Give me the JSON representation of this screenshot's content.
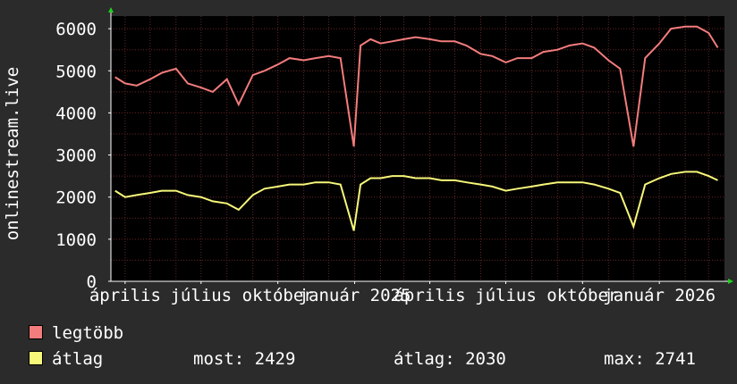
{
  "chart_data": {
    "type": "line",
    "title": "",
    "xlabel": "",
    "ylabel": "onlinestream.live",
    "ylim": [
      0,
      6300
    ],
    "yticks": [
      0,
      1000,
      2000,
      3000,
      4000,
      5000,
      6000
    ],
    "xlim": [
      "2024-03-15",
      "2026-03-20"
    ],
    "xticks": [
      {
        "date": "2024-04-01",
        "label": "április"
      },
      {
        "date": "2024-07-01",
        "label": "július"
      },
      {
        "date": "2024-10-01",
        "label": "október"
      },
      {
        "date": "2025-01-01",
        "label": "január 2025"
      },
      {
        "date": "2025-04-01",
        "label": "április"
      },
      {
        "date": "2025-07-01",
        "label": "július"
      },
      {
        "date": "2025-10-01",
        "label": "október"
      },
      {
        "date": "2026-01-01",
        "label": "január 2026"
      }
    ],
    "grid": true,
    "colors": {
      "max": "#f37c7c",
      "avg": "#f7f77a",
      "background": "#2b2b2b",
      "plot": "#000000",
      "grid": "#6a2525"
    },
    "series": [
      {
        "name": "legtöbb",
        "color": "#f37c7c",
        "points": [
          [
            "2024-03-20",
            4850
          ],
          [
            "2024-04-01",
            4700
          ],
          [
            "2024-04-15",
            4650
          ],
          [
            "2024-05-01",
            4800
          ],
          [
            "2024-05-15",
            4950
          ],
          [
            "2024-06-01",
            5050
          ],
          [
            "2024-06-15",
            4700
          ],
          [
            "2024-07-01",
            4600
          ],
          [
            "2024-07-15",
            4500
          ],
          [
            "2024-08-01",
            4800
          ],
          [
            "2024-08-15",
            4200
          ],
          [
            "2024-09-01",
            4900
          ],
          [
            "2024-09-15",
            5000
          ],
          [
            "2024-10-01",
            5150
          ],
          [
            "2024-10-15",
            5300
          ],
          [
            "2024-11-01",
            5250
          ],
          [
            "2024-11-15",
            5300
          ],
          [
            "2024-12-01",
            5350
          ],
          [
            "2024-12-15",
            5300
          ],
          [
            "2024-12-31",
            3200
          ],
          [
            "2025-01-08",
            5600
          ],
          [
            "2025-01-20",
            5750
          ],
          [
            "2025-02-01",
            5650
          ],
          [
            "2025-02-15",
            5700
          ],
          [
            "2025-03-01",
            5750
          ],
          [
            "2025-03-15",
            5800
          ],
          [
            "2025-04-01",
            5750
          ],
          [
            "2025-04-15",
            5700
          ],
          [
            "2025-05-01",
            5700
          ],
          [
            "2025-05-15",
            5600
          ],
          [
            "2025-06-01",
            5400
          ],
          [
            "2025-06-15",
            5350
          ],
          [
            "2025-07-01",
            5200
          ],
          [
            "2025-07-15",
            5300
          ],
          [
            "2025-08-01",
            5300
          ],
          [
            "2025-08-15",
            5450
          ],
          [
            "2025-09-01",
            5500
          ],
          [
            "2025-09-15",
            5600
          ],
          [
            "2025-10-01",
            5650
          ],
          [
            "2025-10-15",
            5550
          ],
          [
            "2025-11-01",
            5250
          ],
          [
            "2025-11-15",
            5050
          ],
          [
            "2025-12-01",
            3200
          ],
          [
            "2025-12-15",
            5300
          ],
          [
            "2026-01-01",
            5650
          ],
          [
            "2026-01-15",
            6000
          ],
          [
            "2026-02-01",
            6050
          ],
          [
            "2026-02-15",
            6050
          ],
          [
            "2026-03-01",
            5900
          ],
          [
            "2026-03-12",
            5550
          ]
        ]
      },
      {
        "name": "átlag",
        "color": "#f7f77a",
        "points": [
          [
            "2024-03-20",
            2150
          ],
          [
            "2024-04-01",
            2000
          ],
          [
            "2024-04-15",
            2050
          ],
          [
            "2024-05-01",
            2100
          ],
          [
            "2024-05-15",
            2150
          ],
          [
            "2024-06-01",
            2150
          ],
          [
            "2024-06-15",
            2050
          ],
          [
            "2024-07-01",
            2000
          ],
          [
            "2024-07-15",
            1900
          ],
          [
            "2024-08-01",
            1850
          ],
          [
            "2024-08-15",
            1700
          ],
          [
            "2024-09-01",
            2050
          ],
          [
            "2024-09-15",
            2200
          ],
          [
            "2024-10-01",
            2250
          ],
          [
            "2024-10-15",
            2300
          ],
          [
            "2024-11-01",
            2300
          ],
          [
            "2024-11-15",
            2350
          ],
          [
            "2024-12-01",
            2350
          ],
          [
            "2024-12-15",
            2300
          ],
          [
            "2024-12-31",
            1200
          ],
          [
            "2025-01-08",
            2300
          ],
          [
            "2025-01-20",
            2450
          ],
          [
            "2025-02-01",
            2450
          ],
          [
            "2025-02-15",
            2500
          ],
          [
            "2025-03-01",
            2500
          ],
          [
            "2025-03-15",
            2450
          ],
          [
            "2025-04-01",
            2450
          ],
          [
            "2025-04-15",
            2400
          ],
          [
            "2025-05-01",
            2400
          ],
          [
            "2025-05-15",
            2350
          ],
          [
            "2025-06-01",
            2300
          ],
          [
            "2025-06-15",
            2250
          ],
          [
            "2025-07-01",
            2150
          ],
          [
            "2025-07-15",
            2200
          ],
          [
            "2025-08-01",
            2250
          ],
          [
            "2025-08-15",
            2300
          ],
          [
            "2025-09-01",
            2350
          ],
          [
            "2025-09-15",
            2350
          ],
          [
            "2025-10-01",
            2350
          ],
          [
            "2025-10-15",
            2300
          ],
          [
            "2025-11-01",
            2200
          ],
          [
            "2025-11-15",
            2100
          ],
          [
            "2025-12-01",
            1300
          ],
          [
            "2025-12-15",
            2300
          ],
          [
            "2026-01-01",
            2450
          ],
          [
            "2026-01-15",
            2550
          ],
          [
            "2026-02-01",
            2600
          ],
          [
            "2026-02-15",
            2600
          ],
          [
            "2026-03-01",
            2500
          ],
          [
            "2026-03-12",
            2400
          ]
        ]
      }
    ]
  },
  "legend": {
    "max_label": "legtöbb",
    "avg_label": "átlag",
    "now_text": "most: 2429",
    "avg_text": "átlag: 2030",
    "max_text": "max: 2741"
  }
}
